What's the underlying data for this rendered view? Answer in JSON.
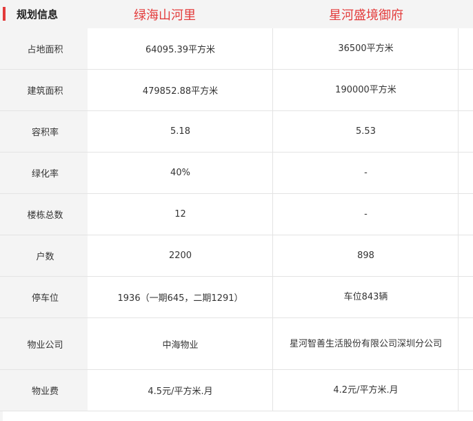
{
  "header": {
    "title": "规划信息",
    "project_a": "绿海山河里",
    "project_b": "星河盛境御府",
    "accent_color": "#e33b3b"
  },
  "rows": [
    {
      "label": "占地面积",
      "a": "64095.39平方米",
      "b": "36500平方米"
    },
    {
      "label": "建筑面积",
      "a": "479852.88平方米",
      "b": "190000平方米"
    },
    {
      "label": "容积率",
      "a": "5.18",
      "b": "5.53"
    },
    {
      "label": "绿化率",
      "a": "40%",
      "b": "-"
    },
    {
      "label": "楼栋总数",
      "a": "12",
      "b": "-"
    },
    {
      "label": "户数",
      "a": "2200",
      "b": "898"
    },
    {
      "label": "停车位",
      "a": "1936（一期645，二期1291）",
      "b": "车位843辆"
    },
    {
      "label": "物业公司",
      "a": "中海物业",
      "b": "星河智善生活股份有限公司深圳分公司"
    },
    {
      "label": "物业费",
      "a": "4.5元/平方米.月",
      "b": "4.2元/平方米.月"
    }
  ]
}
